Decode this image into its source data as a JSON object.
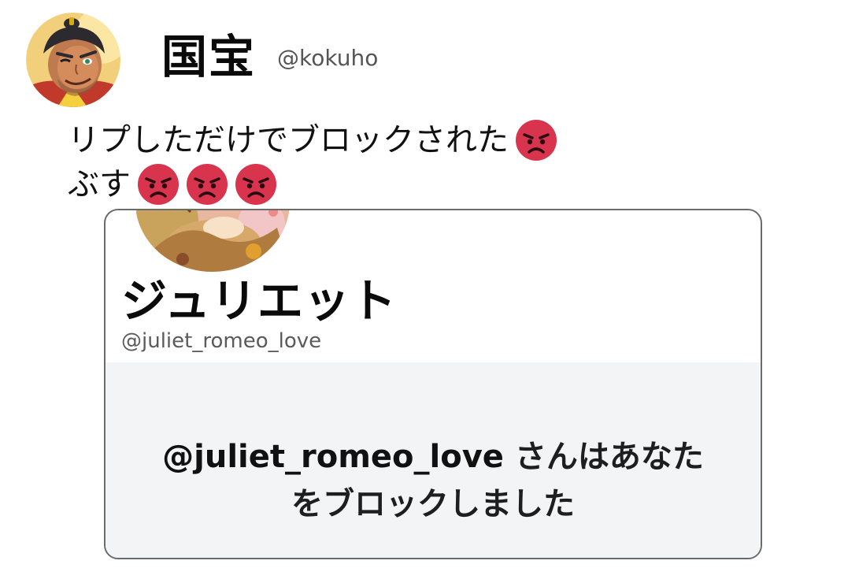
{
  "tweet": {
    "user": {
      "display_name": "国宝",
      "handle": "@kokuho",
      "avatar_icon": "avatar-samurai-icon"
    },
    "lines": [
      {
        "text": "リプしただけでブロックされた",
        "emoji_count": 1
      },
      {
        "text": "ぶす",
        "emoji_count": 3
      }
    ],
    "emoji": "angry-face-icon",
    "colors": {
      "emoji_face": "#d8344e",
      "card_border": "#6b6b6b",
      "card_footer": "#f3f4f6",
      "handle_gray": "#555555"
    }
  },
  "card": {
    "display_name": "ジュリエット",
    "handle": "@juliet_romeo_love",
    "avatar_icon": "avatar-illustration-icon",
    "blocked_handle": "@juliet_romeo_love",
    "blocked_text_1": " さんはあなた",
    "blocked_text_2": "をブロックしました"
  }
}
